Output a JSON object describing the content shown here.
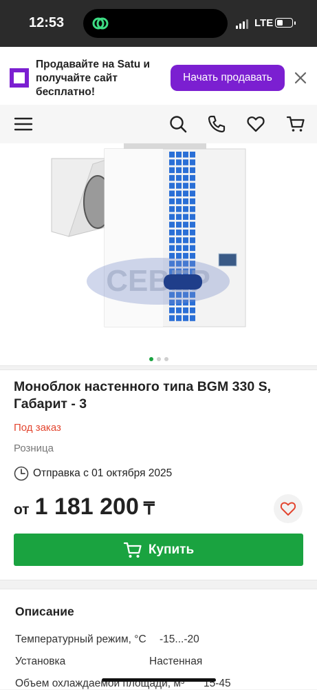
{
  "status_bar": {
    "time": "12:53",
    "network": "LTE"
  },
  "banner": {
    "text": "Продавайте на Satu и получайте сайт бесплатно!",
    "button_label": "Начать продавать",
    "accent_color": "#7b1fd1"
  },
  "header": {
    "icons": [
      "menu-icon",
      "search-icon",
      "phone-icon",
      "heart-icon",
      "cart-icon"
    ]
  },
  "gallery": {
    "slides_total": 3,
    "active_slide": 1
  },
  "product": {
    "title": "Моноблок настенного типа BGM 330 S, Габарит - 3",
    "availability": "Под заказ",
    "sale_type": "Розница",
    "shipping": "Отправка с 01 октября 2025",
    "price_prefix": "от",
    "price": "1 181 200",
    "currency": "₸",
    "buy_label": "Купить",
    "buy_color": "#1aa340"
  },
  "description": {
    "title": "Описание",
    "specs": [
      {
        "label": "Температурный режим, °С",
        "value": "-15...-20"
      },
      {
        "label": "Установка",
        "value": "Настенная"
      },
      {
        "label": "Объем охлаждаемой площади, м³",
        "value": "15-45"
      }
    ]
  }
}
